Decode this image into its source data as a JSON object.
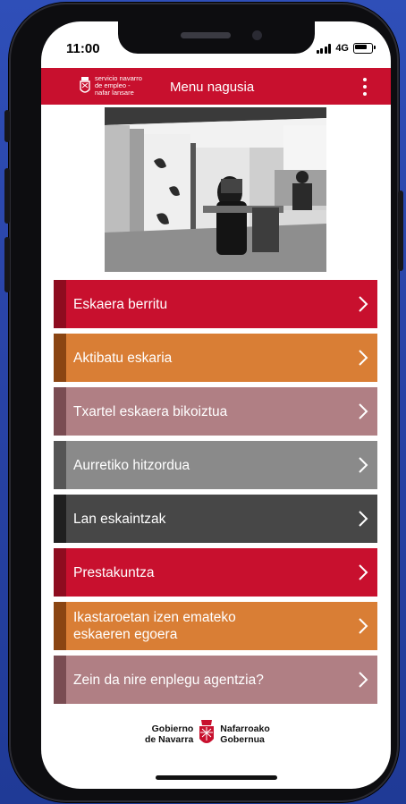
{
  "status_bar": {
    "time": "11:00",
    "network": "4G"
  },
  "header": {
    "logo_lines": [
      "servicio navarro",
      "de empleo -",
      "nafar lansare"
    ],
    "title": "Menu nagusia",
    "menu_icon": "kebab-menu-icon"
  },
  "menu_items": [
    {
      "label": "Eskaera berritu",
      "color": "#c8102e",
      "stripe": "#8e0c1f"
    },
    {
      "label": "Aktibatu eskaria",
      "color": "#d97e35",
      "stripe": "#8a4512"
    },
    {
      "label": "Txartel eskaera bikoiztua",
      "color": "#b07f84",
      "stripe": "#7a4c52"
    },
    {
      "label": "Aurretiko hitzordua",
      "color": "#8a8a8a",
      "stripe": "#555555"
    },
    {
      "label": "Lan eskaintzak",
      "color": "#474747",
      "stripe": "#1f1f1f"
    },
    {
      "label": "Prestakuntza",
      "color": "#c8102e",
      "stripe": "#8e0c1f"
    },
    {
      "label": "Ikastaroetan izen emateko eskaeren egoera",
      "line1": "Ikastaroetan izen emateko",
      "line2": "eskaeren egoera",
      "color": "#d97e35",
      "stripe": "#8a4512"
    },
    {
      "label": "Zein da nire enplegu agentzia?",
      "color": "#b07f84",
      "stripe": "#7a4c52"
    }
  ],
  "footer": {
    "left": [
      "Gobierno",
      "de Navarra"
    ],
    "right": [
      "Nafarroako",
      "Gobernua"
    ]
  },
  "colors": {
    "brand_red": "#c8102e",
    "background": "#2f4fb8"
  }
}
